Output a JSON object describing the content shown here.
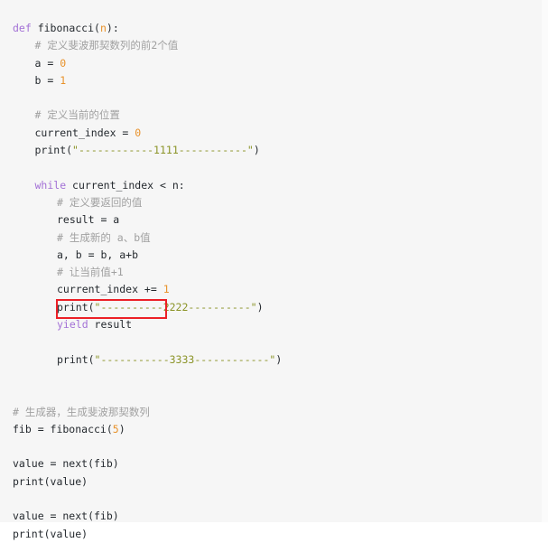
{
  "editor": {
    "language": "python",
    "background_color": "#f6f6f6",
    "highlight_box_color": "#ec2027",
    "keyword_color": "#a371d6",
    "number_color": "#e8922b",
    "string_color": "#8b9428",
    "comment_color": "#a0a0a0",
    "text_color": "#24292e"
  },
  "code": {
    "lines": [
      {
        "id": "l1",
        "indent": 0,
        "tokens": [
          {
            "t": "def ",
            "c": "kw"
          },
          {
            "t": "fibonacci",
            "c": "fn"
          },
          {
            "t": "(",
            "c": "plain"
          },
          {
            "t": "n",
            "c": "param"
          },
          {
            "t": "):",
            "c": "plain"
          }
        ]
      },
      {
        "id": "l2",
        "indent": 1,
        "tokens": [
          {
            "t": "# 定义斐波那契数列的前2个值",
            "c": "cmt"
          }
        ]
      },
      {
        "id": "l3",
        "indent": 1,
        "tokens": [
          {
            "t": "a = ",
            "c": "plain"
          },
          {
            "t": "0",
            "c": "num"
          }
        ]
      },
      {
        "id": "l4",
        "indent": 1,
        "tokens": [
          {
            "t": "b = ",
            "c": "plain"
          },
          {
            "t": "1",
            "c": "num"
          }
        ]
      },
      {
        "id": "l5",
        "indent": 0,
        "tokens": []
      },
      {
        "id": "l6",
        "indent": 1,
        "tokens": [
          {
            "t": "# 定义当前的位置",
            "c": "cmt"
          }
        ]
      },
      {
        "id": "l7",
        "indent": 1,
        "tokens": [
          {
            "t": "current_index = ",
            "c": "plain"
          },
          {
            "t": "0",
            "c": "num"
          }
        ]
      },
      {
        "id": "l8",
        "indent": 1,
        "tokens": [
          {
            "t": "print(",
            "c": "plain"
          },
          {
            "t": "\"------------1111-----------\"",
            "c": "str"
          },
          {
            "t": ")",
            "c": "plain"
          }
        ]
      },
      {
        "id": "l9",
        "indent": 0,
        "tokens": []
      },
      {
        "id": "l10",
        "indent": 1,
        "tokens": [
          {
            "t": "while",
            "c": "kw"
          },
          {
            "t": " current_index < n:",
            "c": "plain"
          }
        ]
      },
      {
        "id": "l11",
        "indent": 2,
        "tokens": [
          {
            "t": "# 定义要返回的值",
            "c": "cmt"
          }
        ]
      },
      {
        "id": "l12",
        "indent": 2,
        "tokens": [
          {
            "t": "result = a",
            "c": "plain"
          }
        ]
      },
      {
        "id": "l13",
        "indent": 2,
        "tokens": [
          {
            "t": "# 生成新的 a、b值",
            "c": "cmt"
          }
        ]
      },
      {
        "id": "l14",
        "indent": 2,
        "tokens": [
          {
            "t": "a, b = b, a+b",
            "c": "plain"
          }
        ]
      },
      {
        "id": "l15",
        "indent": 2,
        "tokens": [
          {
            "t": "# 让当前值+1",
            "c": "cmt"
          }
        ]
      },
      {
        "id": "l16",
        "indent": 2,
        "tokens": [
          {
            "t": "current_index += ",
            "c": "plain"
          },
          {
            "t": "1",
            "c": "num"
          }
        ]
      },
      {
        "id": "l17",
        "indent": 2,
        "tokens": [
          {
            "t": "print(",
            "c": "plain"
          },
          {
            "t": "\"----------2222----------\"",
            "c": "str"
          },
          {
            "t": ")",
            "c": "plain"
          }
        ]
      },
      {
        "id": "l18",
        "indent": 2,
        "tokens": [
          {
            "t": "yield",
            "c": "kw"
          },
          {
            "t": " result",
            "c": "plain"
          }
        ]
      },
      {
        "id": "l19",
        "indent": 0,
        "tokens": []
      },
      {
        "id": "l20",
        "indent": 2,
        "tokens": [
          {
            "t": "print(",
            "c": "plain"
          },
          {
            "t": "\"-----------3333------------\"",
            "c": "str"
          },
          {
            "t": ")",
            "c": "plain"
          }
        ]
      },
      {
        "id": "l21",
        "indent": 0,
        "tokens": []
      },
      {
        "id": "l22",
        "indent": 0,
        "tokens": []
      },
      {
        "id": "l23",
        "indent": 0,
        "tokens": [
          {
            "t": "# 生成器，生成斐波那契数列",
            "c": "cmt"
          }
        ]
      },
      {
        "id": "l24",
        "indent": 0,
        "tokens": [
          {
            "t": "fib = fibonacci(",
            "c": "plain"
          },
          {
            "t": "5",
            "c": "num"
          },
          {
            "t": ")",
            "c": "plain"
          }
        ]
      },
      {
        "id": "l25",
        "indent": 0,
        "tokens": []
      },
      {
        "id": "l26",
        "indent": 0,
        "tokens": [
          {
            "t": "value = next(fib)",
            "c": "plain"
          }
        ]
      },
      {
        "id": "l27",
        "indent": 0,
        "tokens": [
          {
            "t": "print(value)",
            "c": "plain"
          }
        ]
      },
      {
        "id": "l28",
        "indent": 0,
        "tokens": []
      },
      {
        "id": "l29",
        "indent": 0,
        "tokens": [
          {
            "t": "value = next(fib)",
            "c": "plain"
          }
        ]
      },
      {
        "id": "l30",
        "indent": 0,
        "tokens": [
          {
            "t": "print(value)",
            "c": "plain"
          }
        ]
      }
    ]
  },
  "annotations": {
    "highlight": {
      "label": "yield-result-highlight",
      "target_line": "l18",
      "color": "#ec2027"
    }
  }
}
